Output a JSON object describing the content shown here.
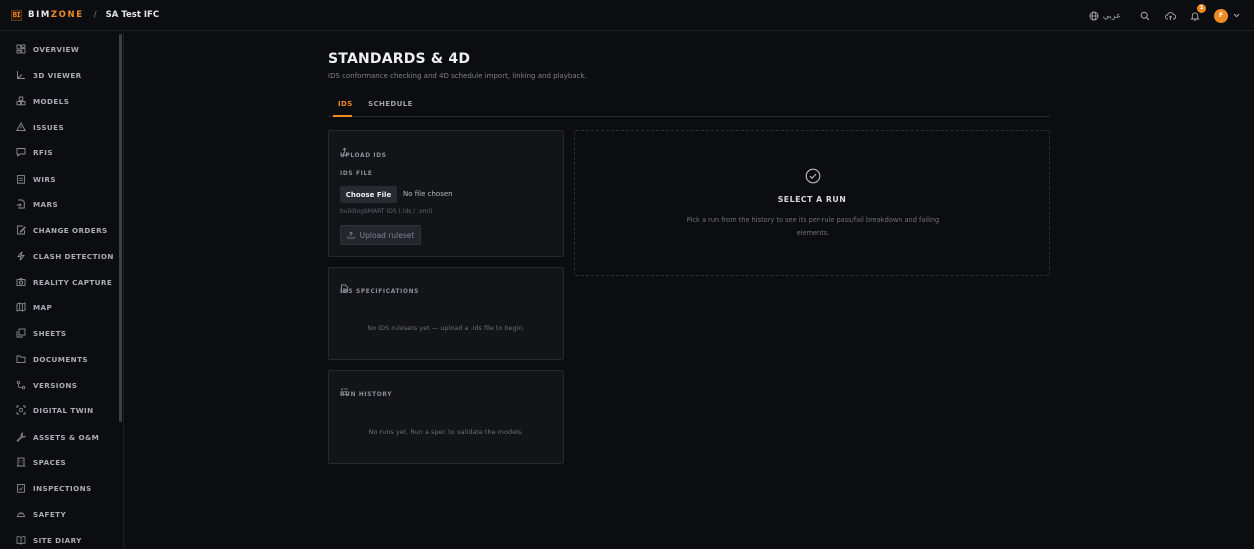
{
  "app": {
    "brand_prefix": "BIM",
    "brand_suffix": "ZONE",
    "logo_mark": "BI",
    "breadcrumb_separator": "/",
    "project": "SA Test IFC",
    "accent_color": "#f08a24"
  },
  "topbar": {
    "language": "عربي",
    "notification_count": "1",
    "avatar_initial": "F",
    "icons": [
      "globe-icon",
      "search-icon",
      "cloud-upload-icon",
      "bell-icon",
      "chevron-down-icon"
    ]
  },
  "sidebar": {
    "items": [
      {
        "label": "OVERVIEW",
        "icon": "dashboard-icon"
      },
      {
        "label": "3D VIEWER",
        "icon": "axis-icon"
      },
      {
        "label": "MODELS",
        "icon": "cubes-icon"
      },
      {
        "label": "ISSUES",
        "icon": "warning-icon"
      },
      {
        "label": "RFIS",
        "icon": "message-icon"
      },
      {
        "label": "WIRS",
        "icon": "clipboard-icon"
      },
      {
        "label": "MARS",
        "icon": "file-arrow-icon"
      },
      {
        "label": "CHANGE ORDERS",
        "icon": "edit-file-icon"
      },
      {
        "label": "CLASH DETECTION",
        "icon": "lightning-icon"
      },
      {
        "label": "REALITY CAPTURE",
        "icon": "camera-icon"
      },
      {
        "label": "MAP",
        "icon": "map-icon"
      },
      {
        "label": "SHEETS",
        "icon": "sheets-icon"
      },
      {
        "label": "DOCUMENTS",
        "icon": "folder-icon"
      },
      {
        "label": "VERSIONS",
        "icon": "versions-icon"
      },
      {
        "label": "DIGITAL TWIN",
        "icon": "scan-icon"
      },
      {
        "label": "ASSETS & O&M",
        "icon": "wrench-icon"
      },
      {
        "label": "SPACES",
        "icon": "building-icon"
      },
      {
        "label": "INSPECTIONS",
        "icon": "checklist-icon"
      },
      {
        "label": "SAFETY",
        "icon": "hard-hat-icon"
      },
      {
        "label": "SITE DIARY",
        "icon": "book-icon"
      }
    ]
  },
  "page": {
    "title": "STANDARDS & 4D",
    "subtitle": "IDS conformance checking and 4D schedule import, linking and playback.",
    "tabs": [
      {
        "label": "IDS",
        "active": true
      },
      {
        "label": "SCHEDULE",
        "active": false
      }
    ]
  },
  "upload_card": {
    "title": "UPLOAD IDS",
    "field_label": "IDS FILE",
    "choose_button": "Choose File",
    "no_file": "No file chosen",
    "hint": "buildingSMART IDS (.ids / .xml)",
    "upload_button": "Upload ruleset"
  },
  "specs_card": {
    "title": "IDS SPECIFICATIONS",
    "empty": "No IDS rulesets yet — upload a .ids file to begin."
  },
  "history_card": {
    "title": "RUN HISTORY",
    "empty": "No runs yet. Run a spec to validate the models."
  },
  "run_panel": {
    "title": "SELECT A RUN",
    "description": "Pick a run from the history to see its per-rule pass/fail breakdown and failing elements."
  }
}
